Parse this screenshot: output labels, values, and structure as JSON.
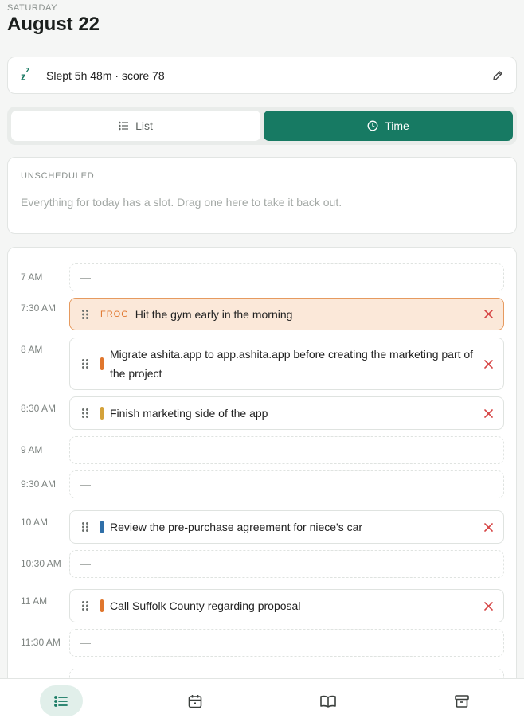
{
  "header": {
    "day": "SATURDAY",
    "date": "August 22"
  },
  "sleep": {
    "icon": "sleep-icon",
    "text": "Slept 5h 48m · score 78"
  },
  "toggle": {
    "list_label": "List",
    "time_label": "Time",
    "active": "Time"
  },
  "unscheduled": {
    "title": "UNSCHEDULED",
    "text": "Everything for today has a slot. Drag one here to take it back out."
  },
  "timeline": {
    "empty_marker": "—",
    "slots": [
      {
        "time": "7 AM"
      },
      {
        "time": "7:30 AM",
        "task": "Hit the gym early in the morning",
        "tag": "FROG"
      },
      {
        "time": "8 AM",
        "task": "Migrate ashita.app to app.ashita.app before creating the marketing part of the project"
      },
      {
        "time": "8:30 AM",
        "task": "Finish marketing side of the app"
      },
      {
        "time": "9 AM"
      },
      {
        "time": "9:30 AM"
      },
      {
        "time": "10 AM",
        "task": "Review the pre-purchase agreement for niece's car"
      },
      {
        "time": "10:30 AM"
      },
      {
        "time": "11 AM",
        "task": "Call Suffolk County regarding proposal"
      },
      {
        "time": "11:30 AM"
      }
    ]
  },
  "colors": {
    "accent": "#177a63",
    "frog_bg": "#fbe8d9",
    "frog_border": "#e69a5f",
    "priority_orange": "#e0762d",
    "priority_amber": "#d4a23a",
    "priority_blue": "#2f6fa8",
    "remove_red": "#d64545"
  },
  "nav": [
    "list-icon",
    "calendar-icon",
    "book-icon",
    "archive-icon"
  ]
}
